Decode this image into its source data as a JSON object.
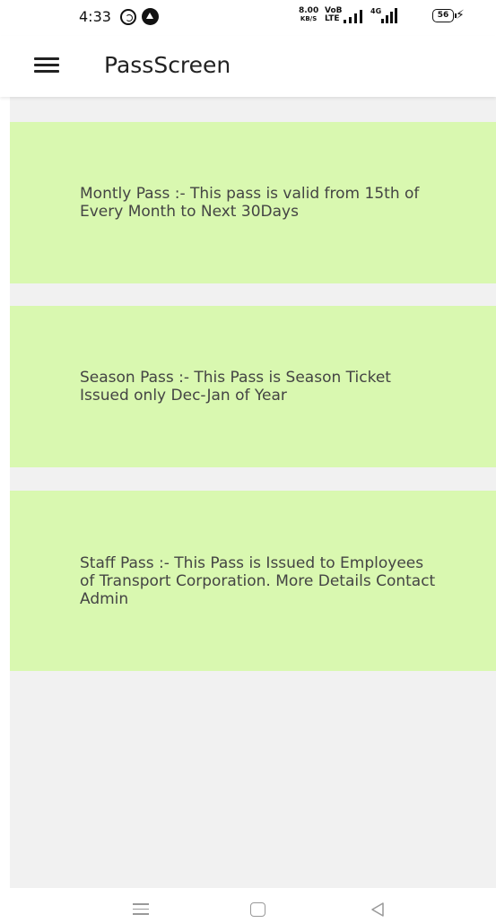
{
  "status_bar": {
    "time": "4:33",
    "net_speed_value": "8.00",
    "net_speed_unit": "KB/S",
    "volte_top": "VoB",
    "volte_bottom": "LTE",
    "network_type": "4G",
    "battery": "56",
    "icons": [
      "whatsapp-icon",
      "navigation-app-icon",
      "signal-icon",
      "signal-4g-icon",
      "battery-icon",
      "charging-icon"
    ]
  },
  "app_bar": {
    "title": "PassScreen",
    "menu_icon": "hamburger-menu-icon"
  },
  "passes": [
    {
      "text": "Montly Pass :- This pass is valid from 15th of Every Month to Next 30Days"
    },
    {
      "text": "Season Pass :- This Pass is Season Ticket Issued only Dec-Jan of Year"
    },
    {
      "text": "Staff Pass :- This Pass is Issued to Employees of Transport Corporation. More Details Contact Admin"
    }
  ],
  "nav_bar": {
    "icons": [
      "recent-apps-icon",
      "home-icon",
      "back-icon"
    ]
  },
  "colors": {
    "card_background": "#d9f8b0",
    "content_background": "#f1f1f1",
    "text": "#444444"
  }
}
